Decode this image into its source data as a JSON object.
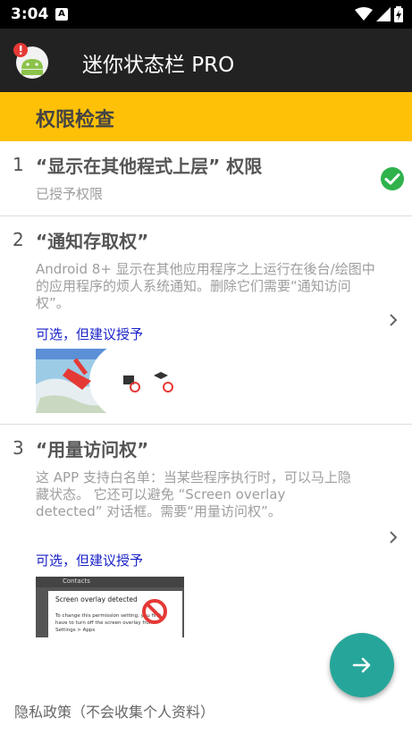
{
  "status_bar": {
    "time": "3:04",
    "notif_icon": "A"
  },
  "app_bar": {
    "title": "迷你状态栏 PRO"
  },
  "section": {
    "title": "权限检查"
  },
  "items": [
    {
      "number": "1",
      "title": "“显示在其他程式上层” 权限",
      "status": "已授予权限"
    },
    {
      "number": "2",
      "title": "“通知存取权”",
      "desc": "Android 8+ 显示在其他应用程序之上运行在後台/绘图中的应用程序的烦人系统通知。删除它们需要“通知访问权”。",
      "optional": "可选，但建议授予"
    },
    {
      "number": "3",
      "title": "“用量访问权”",
      "desc": "这 APP 支持白名单：当某些程序执行时，可以马上隐藏状态。 它还可以避免 “Screen overlay detected” 对话框。需要“用量访问权”。",
      "optional": "可选，但建议授予",
      "image": {
        "app_label": "Contacts",
        "dialog_title": "Screen overlay detected",
        "dialog_text": "To change this permission setting, you first have to turn off the screen overlay from Settings > Apps"
      }
    }
  ],
  "footer": {
    "privacy": "隐私政策（不会收集个人资料）"
  },
  "colors": {
    "accent": "#FFC107",
    "fab": "#26A69A",
    "link": "#1a22c8",
    "granted": "#2fb24c"
  }
}
